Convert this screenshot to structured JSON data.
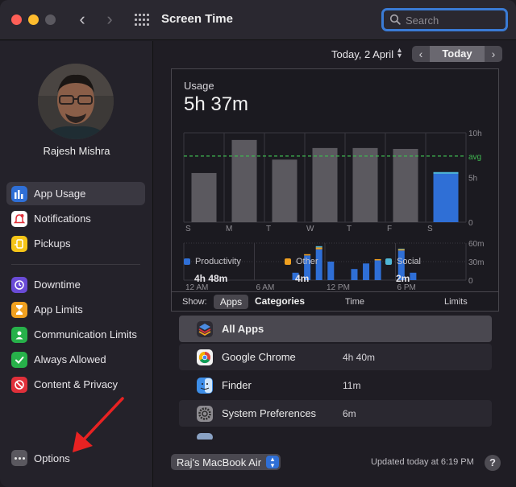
{
  "window": {
    "title": "Screen Time"
  },
  "search": {
    "placeholder": "Search"
  },
  "user": {
    "name": "Rajesh Mishra"
  },
  "sidebar": {
    "items": [
      {
        "label": "App Usage",
        "icon": "bar-chart-icon",
        "color": "#2f6fd6",
        "active": true
      },
      {
        "label": "Notifications",
        "icon": "bell-icon",
        "color": "#e0303a"
      },
      {
        "label": "Pickups",
        "icon": "pickup-icon",
        "color": "#f5c518"
      },
      {
        "label": "Downtime",
        "icon": "downtime-icon",
        "color": "#6a4bd6"
      },
      {
        "label": "App Limits",
        "icon": "hourglass-icon",
        "color": "#f0a020"
      },
      {
        "label": "Communication Limits",
        "icon": "person-icon",
        "color": "#27b14a"
      },
      {
        "label": "Always Allowed",
        "icon": "check-icon",
        "color": "#27b14a"
      },
      {
        "label": "Content & Privacy",
        "icon": "no-entry-icon",
        "color": "#e0303a"
      }
    ],
    "options_label": "Options"
  },
  "date": {
    "label": "Today, 2 April",
    "today_button": "Today"
  },
  "usage": {
    "title": "Usage",
    "total": "5h 37m",
    "categories": [
      {
        "name": "Productivity",
        "value": "4h 48m",
        "color": "#2f6fd6"
      },
      {
        "name": "Other",
        "value": "4m",
        "color": "#f0a020"
      },
      {
        "name": "Social",
        "value": "2m",
        "color": "#4fb7d6"
      }
    ]
  },
  "chart_data": [
    {
      "type": "bar",
      "categories": [
        "S",
        "M",
        "T",
        "W",
        "T",
        "F",
        "S"
      ],
      "values": [
        5.5,
        9.2,
        7.0,
        8.3,
        8.3,
        8.2,
        5.6
      ],
      "highlight_index": 6,
      "ylim": [
        0,
        10
      ],
      "yticks": [
        "10h",
        "5h",
        "0"
      ],
      "average": 7.4,
      "average_label": "avg"
    },
    {
      "type": "bar",
      "x_ticks": [
        "12 AM",
        "6 AM",
        "12 PM",
        "6 PM"
      ],
      "hours": [
        0,
        1,
        2,
        3,
        4,
        5,
        6,
        7,
        8,
        9,
        10,
        11,
        12,
        13,
        14,
        15,
        16,
        17,
        18,
        19,
        20,
        21,
        22,
        23
      ],
      "series": [
        {
          "name": "Productivity",
          "values": [
            0,
            0,
            0,
            0,
            0,
            0,
            0,
            0,
            0,
            12,
            40,
            50,
            30,
            0,
            18,
            27,
            32,
            0,
            48,
            12,
            0,
            0,
            0,
            0
          ]
        },
        {
          "name": "Other",
          "values": [
            0,
            0,
            0,
            0,
            0,
            0,
            0,
            0,
            0,
            0,
            2,
            3,
            0,
            0,
            0,
            0,
            2,
            0,
            2,
            0,
            0,
            0,
            0,
            0
          ]
        },
        {
          "name": "Social",
          "values": [
            0,
            0,
            0,
            0,
            0,
            0,
            0,
            0,
            0,
            0,
            0,
            2,
            0,
            0,
            0,
            0,
            0,
            0,
            1,
            0,
            0,
            0,
            0,
            0
          ]
        }
      ],
      "ylim": [
        0,
        60
      ],
      "yticks": [
        "60m",
        "30m",
        "0"
      ]
    }
  ],
  "list": {
    "show_label": "Show:",
    "tab_apps": "Apps",
    "tab_categories": "Categories",
    "col_time": "Time",
    "col_limits": "Limits",
    "rows": [
      {
        "name": "All Apps",
        "time": "",
        "icon": "stack-icon",
        "selected": true
      },
      {
        "name": "Google Chrome",
        "time": "4h 40m",
        "icon": "chrome-icon"
      },
      {
        "name": "Finder",
        "time": "11m",
        "icon": "finder-icon"
      },
      {
        "name": "System Preferences",
        "time": "6m",
        "icon": "gear-icon"
      }
    ]
  },
  "footer": {
    "device": "Raj's MacBook Air",
    "updated": "Updated today at 6:19 PM",
    "help": "?"
  }
}
